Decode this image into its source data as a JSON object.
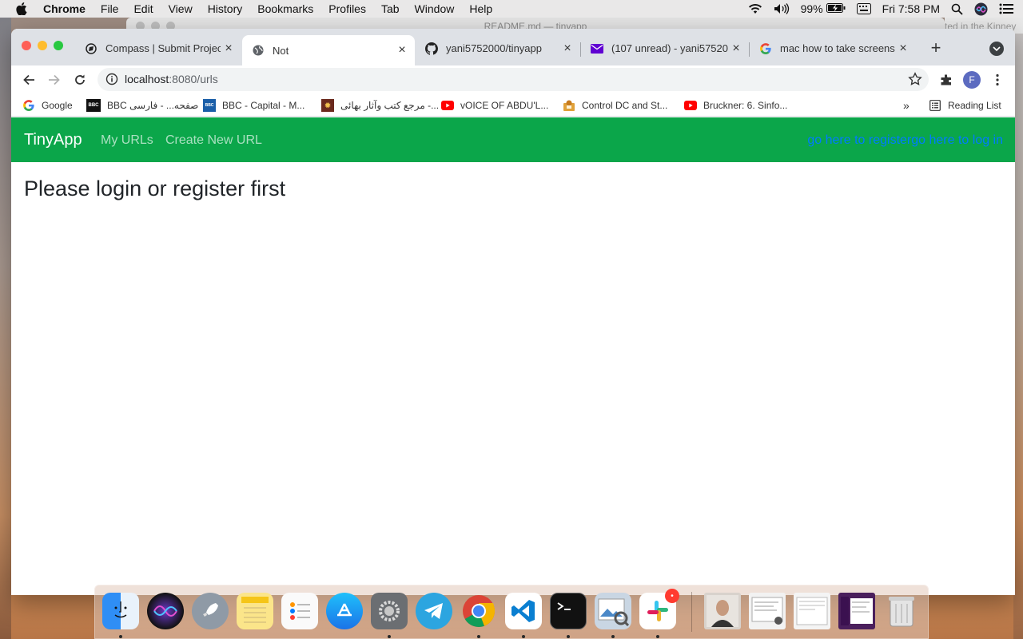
{
  "menubar": {
    "app_name": "Chrome",
    "items": [
      "File",
      "Edit",
      "View",
      "History",
      "Bookmarks",
      "Profiles",
      "Tab",
      "Window",
      "Help"
    ],
    "battery": "99%",
    "clock": "Fri 7:58 PM"
  },
  "background_window": {
    "title": "README.md — tinyapp",
    "partial_text": "ted in the Kinney"
  },
  "tabs": [
    {
      "title": "Compass | Submit Project",
      "icon": "compass-icon"
    },
    {
      "title": "Not",
      "icon": "globe-icon",
      "active": true
    },
    {
      "title": "yani5752000/tinyapp",
      "icon": "github-icon"
    },
    {
      "title": "(107 unread) - yani57520",
      "icon": "mail-icon"
    },
    {
      "title": "mac how to take screensh",
      "icon": "google-icon"
    }
  ],
  "address_bar": {
    "host": "localhost",
    "path": ":8080/urls"
  },
  "bookmarks": [
    {
      "label": "Google",
      "icon": "google-icon"
    },
    {
      "label": "BBC صفحه... - فارسی",
      "icon": "bbc-icon"
    },
    {
      "label": "BBC - Capital - M...",
      "icon": "bbc-capital-icon"
    },
    {
      "label": "مرجع کتب وآثار بهائی -...",
      "icon": "bahai-icon"
    },
    {
      "label": "vOICE OF ABDU'L...",
      "icon": "youtube-icon"
    },
    {
      "label": "Control DC and St...",
      "icon": "folder-icon"
    },
    {
      "label": "Bruckner: 6. Sinfo...",
      "icon": "youtube-icon"
    }
  ],
  "reading_list": "Reading List",
  "profile_initial": "F",
  "app": {
    "brand": "TinyApp",
    "nav": [
      "My URLs",
      "Create New URL"
    ],
    "register_link": "go here to register",
    "login_link": "go here to log in",
    "heading": "Please login or register first"
  },
  "dock": {
    "slack_badge": "•"
  }
}
